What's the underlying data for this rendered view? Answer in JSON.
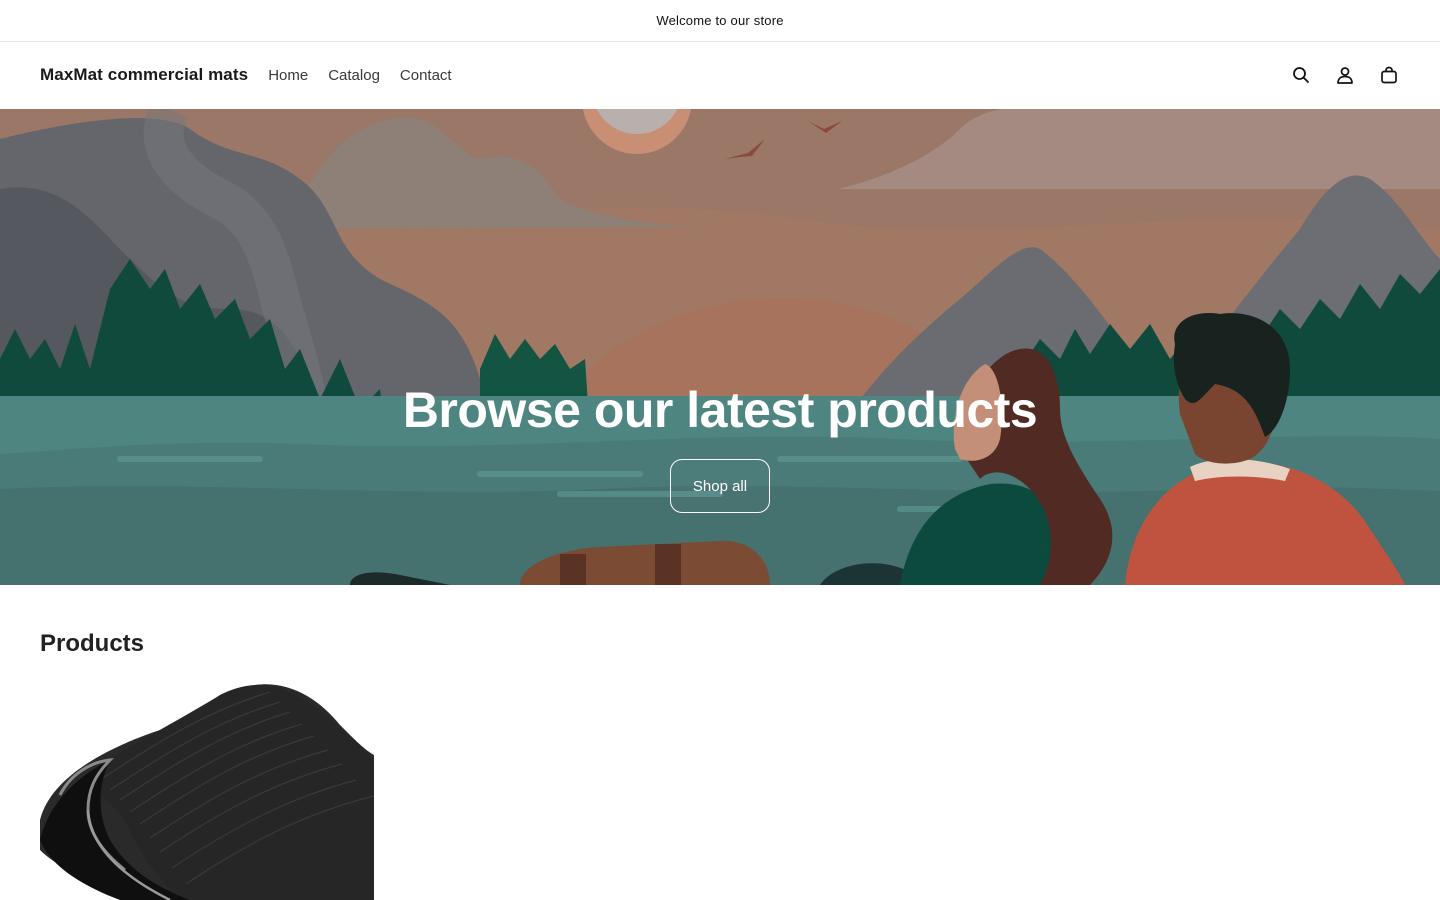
{
  "announcement": {
    "text": "Welcome to our store"
  },
  "header": {
    "logo": "MaxMat commercial mats",
    "nav": [
      {
        "label": "Home"
      },
      {
        "label": "Catalog"
      },
      {
        "label": "Contact"
      }
    ],
    "icons": [
      "search-icon",
      "account-icon",
      "cart-icon"
    ]
  },
  "hero": {
    "title": "Browse our latest products",
    "button_label": "Shop all"
  },
  "products": {
    "heading": "Products",
    "items": [
      {
        "image": "black ribbed commercial floor mat"
      }
    ]
  },
  "colors": {
    "text": "#121212",
    "hero_button_border": "#ffffff"
  }
}
